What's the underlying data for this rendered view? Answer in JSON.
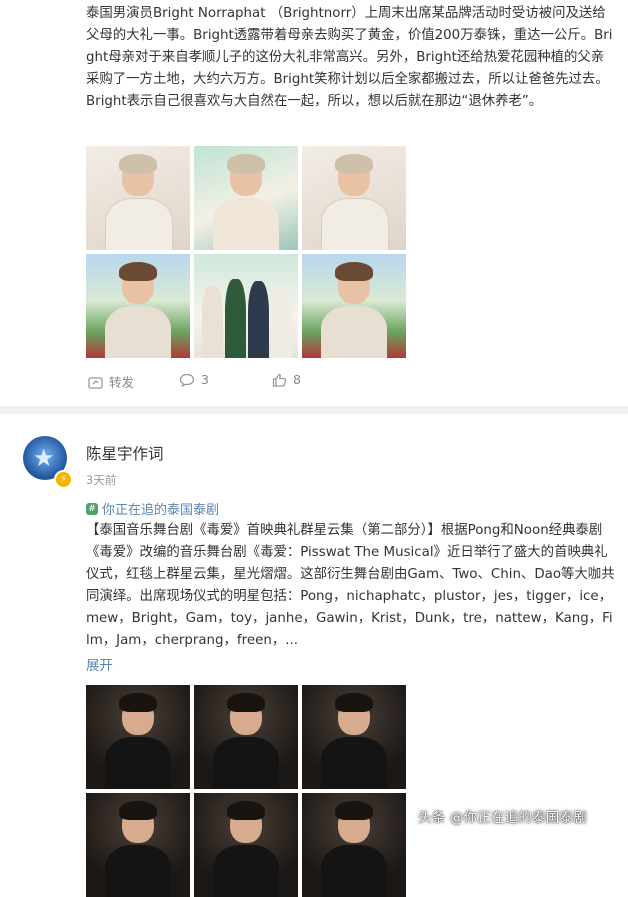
{
  "post1": {
    "text": "泰国男演员Bright Norraphat （Brightnorr）上周末出席某品牌活动时受访被问及送给父母的大礼一事。Bright透露带着母亲去购买了黄金，价值200万泰铢，重达一公斤。Bright母亲对于来自孝顺儿子的这份大礼非常高兴。另外，Bright还给热爱花园种植的父亲采购了一方土地，大约六万方。Bright笑称计划以后全家都搬过去，所以让爸爸先过去。Bright表示自己很喜欢与大自然在一起，所以，想以后就在那边“退休养老”。",
    "actions": {
      "repost": "转发",
      "comments": "3",
      "likes": "8"
    }
  },
  "post2": {
    "author": "陈星宇作词",
    "time": "3天前",
    "topic": "你正在追的泰国泰剧",
    "text": "【泰国音乐舞台剧《毒爱》首映典礼群星云集（第二部分）】根据Pong和Noon经典泰剧《毒爱》改编的音乐舞台剧《毒爱：Pisswat The Musical》近日举行了盛大的首映典礼仪式，红毯上群星云集，星光熠熠。这部衍生舞台剧由Gam、Two、Chin、Dao等大咖共同演绎。出席现场仪式的明星包括：Pong，nichaphatc，plustor，jes，tigger，ice，mew，Bright，Gam，toy，janhe，Gawin，Krist，Dunk，tre，nattew，Kang，Film，Jam，cherprang，freen，...",
    "expand": "展开"
  },
  "watermark": "头条 @你正在追的泰国泰剧",
  "colors": {
    "link": "#5b84b1",
    "divider": "#f2f2f2",
    "badge": "#f7b500"
  }
}
